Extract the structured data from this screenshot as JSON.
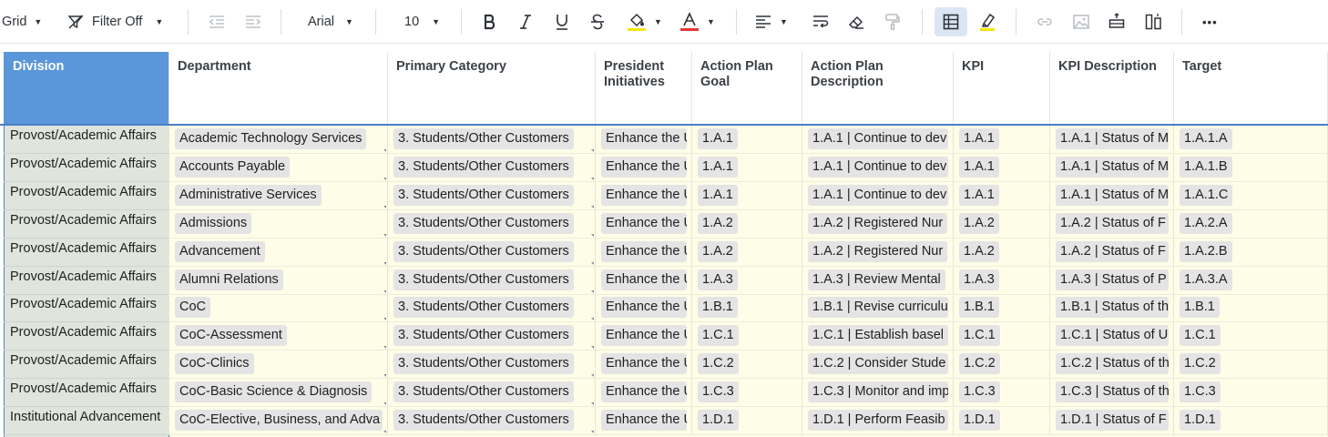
{
  "toolbar": {
    "view_label": "Grid",
    "filter_label": "Filter Off",
    "font_label": "Arial",
    "font_size_label": "10",
    "more_label": "•••",
    "colors": {
      "text_underline": "#e53935",
      "fill_underline": "#f3e600",
      "active_bg": "#dbe6f5"
    }
  },
  "grid": {
    "headers": {
      "division": "Division",
      "department": "Department",
      "primary_category": "Primary Category",
      "president_1": "President",
      "president_2": "Initiatives",
      "apg_1": "Action Plan",
      "apg_2": "Goal",
      "apd_1": "Action Plan",
      "apd_2": "Description",
      "kpi": "KPI",
      "kpi_description": "KPI Description",
      "target": "Target"
    },
    "rows": [
      {
        "division": "Provost/Academic Affairs",
        "department": "Academic Technology Services",
        "category": "3. Students/Other Customers",
        "initiative": "Enhance the U",
        "goal": "1.A.1",
        "desc": "1.A.1 | Continue to dev",
        "kpi": "1.A.1",
        "kpi_desc": "1.A.1 | Status of M",
        "target": "1.A.1.A"
      },
      {
        "division": "Provost/Academic Affairs",
        "department": "Accounts Payable",
        "category": "3. Students/Other Customers",
        "initiative": "Enhance the U",
        "goal": "1.A.1",
        "desc": "1.A.1 | Continue to dev",
        "kpi": "1.A.1",
        "kpi_desc": "1.A.1 | Status of M",
        "target": "1.A.1.B"
      },
      {
        "division": "Provost/Academic Affairs",
        "department": "Administrative Services",
        "category": "3. Students/Other Customers",
        "initiative": "Enhance the U",
        "goal": "1.A.1",
        "desc": "1.A.1 | Continue to dev",
        "kpi": "1.A.1",
        "kpi_desc": "1.A.1 | Status of M",
        "target": "1.A.1.C"
      },
      {
        "division": "Provost/Academic Affairs",
        "department": "Admissions",
        "category": "3. Students/Other Customers",
        "initiative": "Enhance the U",
        "goal": "1.A.2",
        "desc": "1.A.2 | Registered Nur",
        "kpi": "1.A.2",
        "kpi_desc": "1.A.2 | Status of F",
        "target": "1.A.2.A"
      },
      {
        "division": "Provost/Academic Affairs",
        "department": "Advancement",
        "category": "3. Students/Other Customers",
        "initiative": "Enhance the U",
        "goal": "1.A.2",
        "desc": "1.A.2 | Registered Nur",
        "kpi": "1.A.2",
        "kpi_desc": "1.A.2 | Status of F",
        "target": "1.A.2.B"
      },
      {
        "division": "Provost/Academic Affairs",
        "department": "Alumni Relations",
        "category": "3. Students/Other Customers",
        "initiative": "Enhance the U",
        "goal": "1.A.3",
        "desc": "1.A.3 | Review Mental",
        "kpi": "1.A.3",
        "kpi_desc": "1.A.3 | Status of P",
        "target": "1.A.3.A"
      },
      {
        "division": "Provost/Academic Affairs",
        "department": "CoC",
        "category": "3. Students/Other Customers",
        "initiative": "Enhance the U",
        "goal": "1.B.1",
        "desc": "1.B.1 | Revise curriculu",
        "kpi": "1.B.1",
        "kpi_desc": "1.B.1 | Status of th",
        "target": "1.B.1"
      },
      {
        "division": "Provost/Academic Affairs",
        "department": "CoC-Assessment",
        "category": "3. Students/Other Customers",
        "initiative": "Enhance the U",
        "goal": "1.C.1",
        "desc": "1.C.1 | Establish basel",
        "kpi": "1.C.1",
        "kpi_desc": "1.C.1 | Status of U",
        "target": "1.C.1"
      },
      {
        "division": "Provost/Academic Affairs",
        "department": "CoC-Clinics",
        "category": "3. Students/Other Customers",
        "initiative": "Enhance the U",
        "goal": "1.C.2",
        "desc": "1.C.2 | Consider Stude",
        "kpi": "1.C.2",
        "kpi_desc": "1.C.2 | Status of th",
        "target": "1.C.2"
      },
      {
        "division": "Provost/Academic Affairs",
        "department": "CoC-Basic Science & Diagnosis",
        "category": "3. Students/Other Customers",
        "initiative": "Enhance the U",
        "goal": "1.C.3",
        "desc": "1.C.3 | Monitor and imp",
        "kpi": "1.C.3",
        "kpi_desc": "1.C.3 | Status of th",
        "target": "1.C.3"
      },
      {
        "division": "Institutional Advancement",
        "department": "CoC-Elective, Business, and Adva",
        "category": "3. Students/Other Customers",
        "initiative": "Enhance the U",
        "goal": "1.D.1",
        "desc": "1.D.1 | Perform Feasib",
        "kpi": "1.D.1",
        "kpi_desc": "1.D.1 | Status of F",
        "target": "1.D.1"
      }
    ]
  }
}
